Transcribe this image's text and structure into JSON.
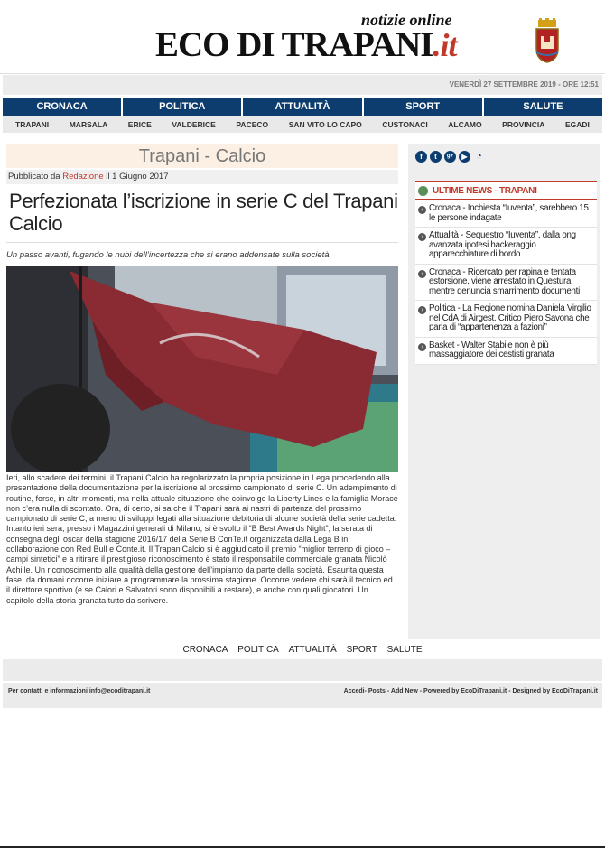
{
  "header": {
    "tagline": "notizie online",
    "logo_main": "ECO DI TRAPANI",
    "logo_suffix": ".it"
  },
  "datebar": {
    "text": "VENERDÌ 27 SETTEMBRE 2019 - ORE 12:51"
  },
  "main_nav": [
    "CRONACA",
    "POLITICA",
    "ATTUALITÀ",
    "SPORT",
    "SALUTE"
  ],
  "sub_nav": [
    "TRAPANI",
    "MARSALA",
    "ERICE",
    "VALDERICE",
    "PACECO",
    "SAN VITO LO CAPO",
    "CUSTONACI",
    "ALCAMO",
    "PROVINCIA",
    "EGADI"
  ],
  "article": {
    "category": "Trapani - Calcio",
    "published_prefix": "Pubblicato da",
    "author": "Redazione",
    "published_suffix": "il 1 Giugno 2017",
    "title": "Perfezionata l’iscrizione in serie C del Trapani Calcio",
    "lead": "Un passo avanti, fugando le nubi dell’incertezza che si erano addensate sulla società.",
    "body": "Ieri, allo scadere dei termini, il Trapani Calcio ha regolarizzato la propria posizione in Lega procedendo alla presentazione della documentazione per la iscrizione al prossimo campionato di serie C. Un adempimento di routine, forse, in altri momenti, ma nella attuale situazione che coinvolge la Liberty Lines e la famiglia Morace non c’era nulla di scontato. Ora, di certo, si sa che il Trapani sarà ai nastri di partenza del prossimo campionato di serie C, a meno di sviluppi legati alla situazione debitoria di alcune società della serie cadetta. Intanto ieri sera, presso i Magazzini generali di Milano, si è svolto il “B Best Awards Night”, la serata di consegna degli oscar della stagione 2016/17 della Serie B ConTe.it organizzata dalla Lega B in collaborazione con Red Bull e Conte.it. Il TrapaniCalcio si è aggiudicato il premio “miglior terreno di gioco – campi sintetici” e a ritirare il prestigioso riconoscimento è stato il responsabile commerciale granata Nicolò Achille. Un riconoscimento alla qualità della gestione dell’impianto da parte della società. Esaurita questa fase, da domani occorre iniziare a programmare la prossima stagione. Occorre vedere chi sarà il tecnico ed il direttore sportivo (e se Calori e Salvatori sono disponibili a restare), e anche con quali giocatori. Un capitolo della storia granata tutto da scrivere."
  },
  "sidebar": {
    "social_icons": [
      "f",
      "t",
      "g+",
      "yt",
      "rss"
    ],
    "news_heading": "ULTIME NEWS - TRAPANI",
    "news": [
      {
        "cat": "Cronaca",
        "text": "Cronaca - Inchiesta “Iuventa”, sarebbero 15 le persone indagate"
      },
      {
        "cat": "Attualità",
        "text": "Attualità - Sequestro “Iuventa”, dalla ong avanzata ipotesi hackeraggio apparecchiature di bordo"
      },
      {
        "cat": "Cronaca",
        "text": "Cronaca - Ricercato per rapina e tentata estorsione, viene arrestato in Questura mentre denuncia smarrimento documenti"
      },
      {
        "cat": "Politica",
        "text": "Politica - La Regione nomina Daniela Virgilio nel CdA di Airgest. Critico Piero Savona che parla di “appartenenza a fazioni”"
      },
      {
        "cat": "Basket",
        "text": "Basket - Walter Stabile non è più massaggiatore dei cestisti granata"
      }
    ]
  },
  "footer": {
    "nav": [
      "CRONACA",
      "POLITICA",
      "ATTUALITÀ",
      "SPORT",
      "SALUTE"
    ],
    "contact": "Per contatti e informazioni info@ecoditrapani.it",
    "credits": "Accedi- Posts - Add New - Powered by EcoDiTrapani.it - Designed by EcoDiTrapani.it"
  },
  "colors": {
    "nav_blue": "#0d3d6e",
    "accent_red": "#c0392b",
    "flag_maroon": "#8a2a32"
  }
}
